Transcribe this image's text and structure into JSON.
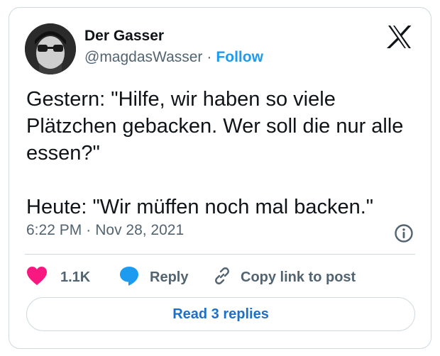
{
  "author": {
    "display_name": "Der Gasser",
    "handle": "@magdasWasser",
    "separator": "·",
    "follow_label": "Follow"
  },
  "tweet": {
    "lines": [
      "Gestern: \"Hilfe, wir haben so viele",
      "Plätzchen gebacken. Wer soll die nur alle",
      "essen?\"",
      "Heute: \"Wir müffen noch mal backen.\""
    ],
    "time": "6:22 PM",
    "separator": "·",
    "date": "Nov 28, 2021"
  },
  "actions": {
    "like_count": "1.1K",
    "reply_label": "Reply",
    "copy_link_label": "Copy link to post"
  },
  "footer": {
    "read_replies_label": "Read 3 replies"
  },
  "icons": {
    "brand": "x-logo-icon",
    "info": "info-icon",
    "like": "heart-icon",
    "reply": "speech-bubble-icon",
    "copy": "link-icon"
  },
  "colors": {
    "accent": "#1d9bf0",
    "like": "#f91880",
    "text_primary": "#0f1419",
    "text_secondary": "#536471",
    "border": "#cfd9de"
  }
}
